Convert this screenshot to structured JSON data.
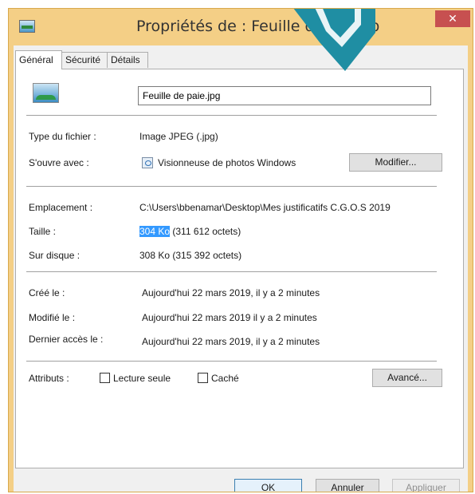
{
  "window": {
    "title": "Propriétés de : Feuille de paie.jp",
    "close_glyph": "✕"
  },
  "tabs": [
    {
      "label": "Général"
    },
    {
      "label": "Sécurité"
    },
    {
      "label": "Détails"
    }
  ],
  "general": {
    "file_name": "Feuille de paie.jpg",
    "file_type_label": "Type du fichier :",
    "file_type_value": "Image JPEG (.jpg)",
    "opens_with_label": "S'ouvre avec :",
    "opens_with_value": "Visionneuse de photos Windows",
    "change_button": "Modifier...",
    "location_label": "Emplacement :",
    "location_value": "C:\\Users\\bbenamar\\Desktop\\Mes justificatifs C.G.O.S 2019",
    "size_label": "Taille :",
    "size_selected": "304 Ko",
    "size_rest": " (311 612 octets)",
    "disk_label": "Sur disque :",
    "disk_value": "308 Ko (315 392 octets)",
    "created_label": "Créé le :",
    "created_value": "Aujourd'hui 22 mars 2019, il y a 2 minutes",
    "modified_label": "Modifié le :",
    "modified_value": "Aujourd'hui 22 mars 2019  il y a 2 minutes",
    "accessed_label": "Dernier accès le :",
    "accessed_value": "Aujourd'hui 22 mars 2019, il y a 2 minutes",
    "attributes_label": "Attributs :",
    "readonly_label": "Lecture seule",
    "readonly_checked": false,
    "hidden_label": "Caché",
    "hidden_checked": false,
    "advanced_button": "Avancé..."
  },
  "footer": {
    "ok": "OK",
    "cancel": "Annuler",
    "apply": "Appliquer"
  },
  "colors": {
    "title_bar": "#f4cf86",
    "close_button": "#c75050",
    "selection": "#3399ff",
    "overlay_arrow": "#1f8ea3"
  }
}
